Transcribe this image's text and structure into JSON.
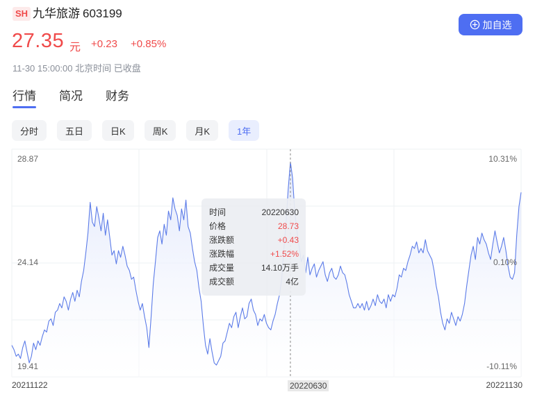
{
  "stock": {
    "market": "SH",
    "name": "九华旅游",
    "code": "603199",
    "price": "27.35",
    "unit": "元",
    "change": "+0.23",
    "change_pct": "+0.85%",
    "status": "11-30 15:00:00 北京时间 已收盘"
  },
  "actions": {
    "add_watch": "加自选",
    "add_icon": "plus-circle-icon"
  },
  "tabs": [
    {
      "label": "行情",
      "active": true
    },
    {
      "label": "简况",
      "active": false
    },
    {
      "label": "财务",
      "active": false
    }
  ],
  "periods": [
    {
      "label": "分时",
      "active": false
    },
    {
      "label": "五日",
      "active": false
    },
    {
      "label": "日K",
      "active": false
    },
    {
      "label": "周K",
      "active": false
    },
    {
      "label": "月K",
      "active": false
    },
    {
      "label": "1年",
      "active": true
    }
  ],
  "chart_data": {
    "type": "area",
    "y_left_ticks": [
      "28.87",
      "24.14",
      "19.41"
    ],
    "y_right_ticks": [
      "10.31%",
      "0.10%",
      "-10.11%"
    ],
    "ylim": [
      19.41,
      28.87
    ],
    "x_ticks": [
      "20211122",
      "20220630",
      "20221130"
    ],
    "highlight_x": "20220630",
    "colors": {
      "line": "#5b7be8",
      "fill": "#eef2fd",
      "up": "#f04a4a"
    },
    "values": [
      20.4,
      20.2,
      19.9,
      20.0,
      19.8,
      20.3,
      20.6,
      20.1,
      19.6,
      19.9,
      20.5,
      20.2,
      20.6,
      20.4,
      20.8,
      21.1,
      21.0,
      21.5,
      21.6,
      21.3,
      21.9,
      22.0,
      22.3,
      22.1,
      22.6,
      22.4,
      22.0,
      22.5,
      22.8,
      22.4,
      22.9,
      22.6,
      23.3,
      23.8,
      24.6,
      25.5,
      26.9,
      26.0,
      25.8,
      26.7,
      26.2,
      25.6,
      26.4,
      25.4,
      26.1,
      25.3,
      24.5,
      24.7,
      24.1,
      24.7,
      24.4,
      24.9,
      24.5,
      24.0,
      23.8,
      23.4,
      23.5,
      22.9,
      22.4,
      22.0,
      22.3,
      21.7,
      21.2,
      20.3,
      21.7,
      23.2,
      24.2,
      25.3,
      25.6,
      25.0,
      25.9,
      25.4,
      26.5,
      26.1,
      27.1,
      26.6,
      26.3,
      25.6,
      26.6,
      26.1,
      27.0,
      25.8,
      25.5,
      24.8,
      24.2,
      23.8,
      23.0,
      22.4,
      21.3,
      20.4,
      20.0,
      20.7,
      20.1,
      19.6,
      19.5,
      19.7,
      19.9,
      20.5,
      20.6,
      21.0,
      21.4,
      21.2,
      21.7,
      21.9,
      21.2,
      21.7,
      22.1,
      21.6,
      21.7,
      22.3,
      22.5,
      22.0,
      21.8,
      21.3,
      21.6,
      21.5,
      21.8,
      21.4,
      21.2,
      21.1,
      21.5,
      21.8,
      22.3,
      22.7,
      23.4,
      24.8,
      26.0,
      27.5,
      28.73,
      28.0,
      26.5,
      25.6,
      24.9,
      24.2,
      24.5,
      23.7,
      24.4,
      23.6,
      23.9,
      24.1,
      23.5,
      23.8,
      24.0,
      24.2,
      23.6,
      23.3,
      23.7,
      23.9,
      23.5,
      23.4,
      23.6,
      24.0,
      23.7,
      23.6,
      23.2,
      22.7,
      22.4,
      22.1,
      22.1,
      22.3,
      22.1,
      22.3,
      22.0,
      22.4,
      22.0,
      22.2,
      22.5,
      22.2,
      22.7,
      22.4,
      22.3,
      22.5,
      22.1,
      22.7,
      22.4,
      22.7,
      22.6,
      23.0,
      23.6,
      23.5,
      23.9,
      23.8,
      24.2,
      24.5,
      24.9,
      24.8,
      25.1,
      24.6,
      24.8,
      24.6,
      25.2,
      24.7,
      24.5,
      24.3,
      23.8,
      23.1,
      22.6,
      21.9,
      21.4,
      21.1,
      21.6,
      21.4,
      21.9,
      21.6,
      21.3,
      21.7,
      21.5,
      21.8,
      22.3,
      23.1,
      23.8,
      24.5,
      24.9,
      24.3,
      25.3,
      25.0,
      25.5,
      25.2,
      25.0,
      24.6,
      24.3,
      25.0,
      25.6,
      25.1,
      24.6,
      24.9,
      25.3,
      24.7,
      24.0,
      23.5,
      23.4,
      23.7,
      25.4,
      26.7,
      27.35
    ],
    "tooltip": {
      "date": "20220630",
      "rows": [
        {
          "k": "时间",
          "v": "20220630",
          "red": false
        },
        {
          "k": "价格",
          "v": "28.73",
          "red": true
        },
        {
          "k": "涨跌额",
          "v": "+0.43",
          "red": true
        },
        {
          "k": "涨跌幅",
          "v": "+1.52%",
          "red": true
        },
        {
          "k": "成交量",
          "v": "14.10万手",
          "red": false
        },
        {
          "k": "成交额",
          "v": "4亿",
          "red": false
        }
      ]
    }
  }
}
